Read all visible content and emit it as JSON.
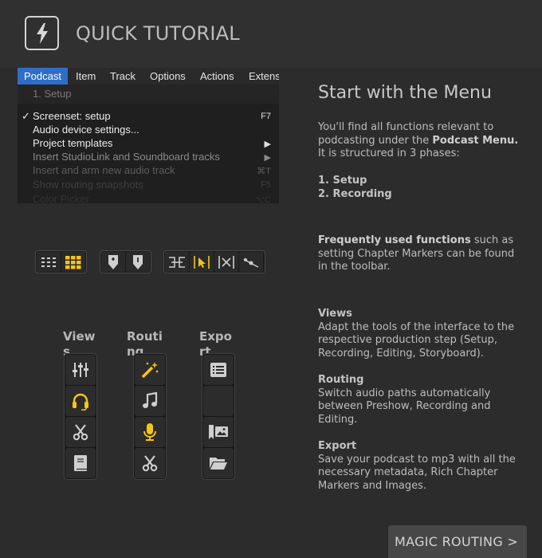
{
  "header": {
    "title": "QUICK TUTORIAL",
    "logo_icon": "lightning-icon"
  },
  "menu": {
    "bar": [
      "Podcast",
      "Item",
      "Track",
      "Options",
      "Actions",
      "Extens"
    ],
    "section": "1. Setup",
    "items": [
      {
        "label": "Screenset: setup",
        "shortcut": "F7",
        "checked": true
      },
      {
        "label": "Audio device settings...",
        "shortcut": ""
      },
      {
        "label": "Project templates",
        "shortcut": "▶"
      },
      {
        "label": "Insert StudioLink and Soundboard tracks",
        "shortcut": "▶"
      },
      {
        "label": "Insert and arm new audio track",
        "shortcut": "⌘T"
      },
      {
        "label": "Show routing snapshots",
        "shortcut": "F5"
      },
      {
        "label": "Color Picker",
        "shortcut": "⌥C"
      }
    ],
    "check_mark": "✓"
  },
  "columns": {
    "views": {
      "label": "Views",
      "icons": [
        "mixer-icon",
        "headphones-icon",
        "scissors-icon",
        "book-icon"
      ]
    },
    "routing": {
      "label": "Routing",
      "icons": [
        "magic-wand-icon",
        "music-note-icon",
        "microphone-icon",
        "scissors-icon"
      ]
    },
    "export": {
      "label": "Export",
      "icons": [
        "list-icon",
        "empty",
        "image-marker-icon",
        "folder-icon"
      ]
    }
  },
  "right": {
    "heading": "Start with the Menu",
    "intro_1": "You'll find all functions relevant to podcasting under the ",
    "intro_bold": "Podcast Menu.",
    "intro_2": "It is structured in 3 phases:",
    "phase_1": "1. Setup",
    "phase_2": "2. Recording",
    "freq_bold": "Frequently used functions",
    "freq_1": " such as setting Chapter Markers can be found",
    "freq_2": "in the toolbar.",
    "views_h": "Views",
    "views_t": "Adapt the tools of the interface to the respective production step (Setup, Recording, Editing, Storyboard).",
    "routing_h": "Routing",
    "routing_t": "Switch audio paths automatically between Preshow, Recording and Editing.",
    "export_h": "Export",
    "export_t": "Save your podcast to mp3 with all the necessary metadata, Rich Chapter Markers and Images."
  },
  "next_button": "MAGIC ROUTING >",
  "colors": {
    "accent": "#f5c518",
    "menu_highlight": "#2f6ec8",
    "background": "#2c2c2c"
  }
}
